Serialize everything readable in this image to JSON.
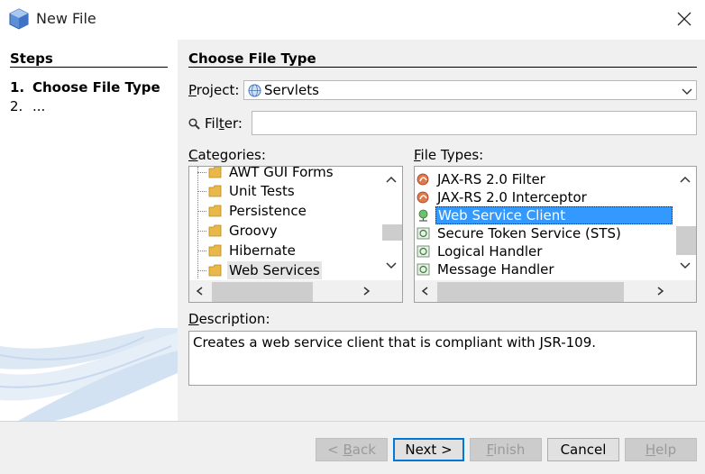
{
  "window": {
    "title": "New File"
  },
  "steps": {
    "heading": "Steps",
    "items": [
      {
        "num": "1.",
        "label": "Choose File Type"
      },
      {
        "num": "2.",
        "label": "..."
      }
    ]
  },
  "main": {
    "heading": "Choose File Type",
    "project": {
      "label_first": "P",
      "label_rest": "roject:",
      "value": "Servlets"
    },
    "filter": {
      "label_pre": "Fil",
      "label_u": "t",
      "label_post": "er:",
      "value": ""
    },
    "categories": {
      "label_first": "C",
      "label_rest": "ategories:",
      "items": [
        {
          "label": "AWT GUI Forms"
        },
        {
          "label": "Unit Tests"
        },
        {
          "label": "Persistence"
        },
        {
          "label": "Groovy"
        },
        {
          "label": "Hibernate"
        },
        {
          "label": "Web Services",
          "selected": true
        }
      ]
    },
    "file_types": {
      "label_first": "F",
      "label_rest": "ile Types:",
      "items": [
        {
          "label": "JAX-RS 2.0 Filter",
          "icon": "jaxrs-icon"
        },
        {
          "label": "JAX-RS 2.0 Interceptor",
          "icon": "jaxrs-icon"
        },
        {
          "label": "Web Service Client",
          "icon": "web-service-client-icon",
          "selected": true
        },
        {
          "label": "Secure Token Service (STS)",
          "icon": "handler-icon"
        },
        {
          "label": "Logical Handler",
          "icon": "handler-icon"
        },
        {
          "label": "Message Handler",
          "icon": "handler-icon"
        }
      ]
    },
    "description": {
      "label_first": "D",
      "label_rest": "escription:",
      "text": "Creates a web service client that is compliant with JSR-109."
    }
  },
  "buttons": {
    "back_pre": "< ",
    "back_u": "B",
    "back_post": "ack",
    "next": "Next >",
    "finish_u": "F",
    "finish_post": "inish",
    "cancel": "Cancel",
    "help_u": "H",
    "help_post": "elp"
  },
  "colors": {
    "selection": "#3399ff",
    "selection_border": "#0a246a",
    "folder": "#e8b94a",
    "default_button_border": "#0078d7"
  }
}
